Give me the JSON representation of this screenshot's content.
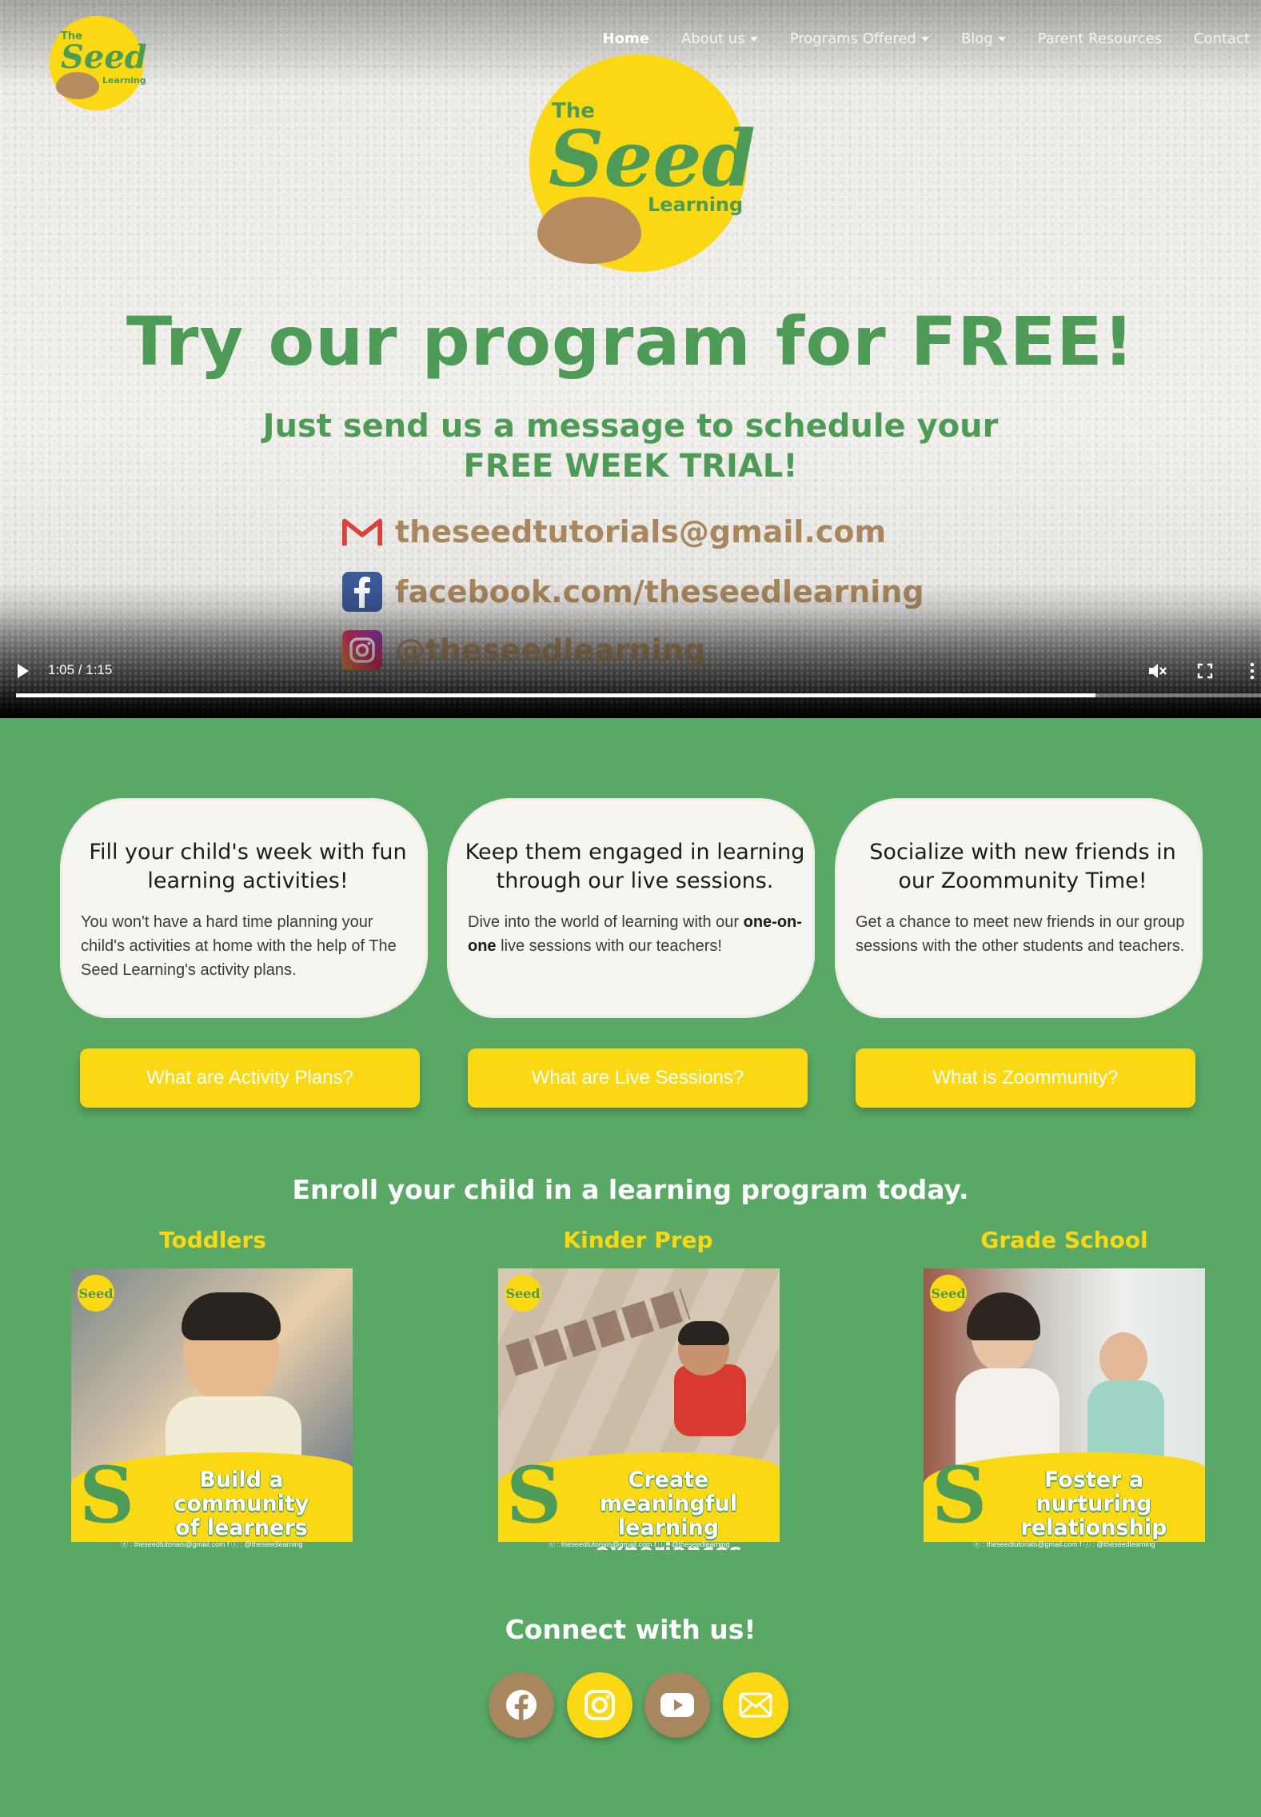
{
  "nav": {
    "logo": {
      "the": "The",
      "seed": "Seed",
      "learning": "Learning"
    },
    "items": [
      {
        "label": "Home",
        "active": true,
        "dropdown": false
      },
      {
        "label": "About us",
        "active": false,
        "dropdown": true
      },
      {
        "label": "Programs Offered",
        "active": false,
        "dropdown": true
      },
      {
        "label": "Blog",
        "active": false,
        "dropdown": true
      },
      {
        "label": "Parent Resources",
        "active": false,
        "dropdown": false
      },
      {
        "label": "Contact",
        "active": false,
        "dropdown": false
      }
    ]
  },
  "hero": {
    "logo": {
      "the": "The",
      "seed": "Seed",
      "learning": "Learning"
    },
    "title": "Try our program for FREE!",
    "subtitle_line1": "Just send us a message to schedule your",
    "subtitle_line2": "FREE WEEK TRIAL!",
    "contacts": [
      {
        "icon": "gmail-icon",
        "text": "theseedtutorials@gmail.com"
      },
      {
        "icon": "facebook-icon",
        "text": "facebook.com/theseedlearning"
      },
      {
        "icon": "instagram-icon",
        "text": "@theseedlearning"
      }
    ]
  },
  "video": {
    "time": "1:05 / 1:15",
    "progress": 0.867,
    "muted": true
  },
  "features": [
    {
      "title": "Fill your child's week with fun learning activities!",
      "body": "You won't have a hard time planning your child's activities at home with the help of The Seed Learning's activity plans.",
      "button": "What are Activity Plans?"
    },
    {
      "title": "Keep them engaged in learning through our live sessions.",
      "body_before": "Dive into the world of learning with our ",
      "body_bold": "one-on-one",
      "body_after": " live sessions with our teachers!",
      "button": "What are Live Sessions?"
    },
    {
      "title": "Socialize with new friends in our Zoommunity Time!",
      "body": "Get a chance to meet new friends in our group sessions with the other students and teachers.",
      "button": "What is Zoommunity?"
    }
  ],
  "programs": {
    "heading": "Enroll your child in a learning program today.",
    "items": [
      {
        "title": "Toddlers",
        "caption_1": "Build a community",
        "caption_2": "of learners",
        "footer": "ⓔ : theseedtutorials@gmail.com   f ⓘ : @theseedlearning"
      },
      {
        "title": "Kinder Prep",
        "caption_1": "Create meaningful",
        "caption_2": "learning experiences",
        "footer": "ⓔ : theseedtutorials@gmail.com   f ⓘ : @theseedlearning"
      },
      {
        "title": "Grade School",
        "caption_1": "Foster a nurturing",
        "caption_2": "relationship",
        "footer": "ⓔ : theseedtutorials@gmail.com   f ⓘ : @theseedlearning"
      }
    ],
    "mini_logo": "Seed",
    "banner_letter": "S"
  },
  "connect": {
    "heading": "Connect with us!",
    "icons": [
      "facebook-icon",
      "instagram-icon",
      "youtube-icon",
      "email-icon"
    ]
  },
  "colors": {
    "green": "#5aa866",
    "brand_green": "#4e9b57",
    "yellow": "#fbd814",
    "brown": "#a8875e"
  }
}
